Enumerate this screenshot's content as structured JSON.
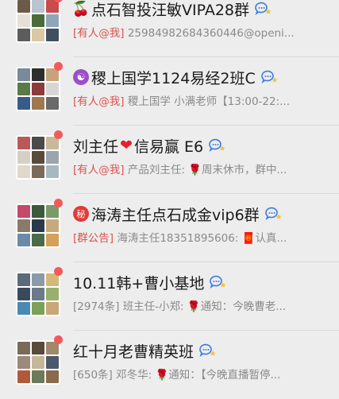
{
  "chats": [
    {
      "title_emoji": "🍒",
      "title": "点石智投汪敏VIPA28群",
      "tag": "[有人@我]",
      "preview": "25984982684360446@openi...",
      "avatar_colors": [
        "#6b5a4a",
        "#b8c4cf",
        "#c94b4b",
        "#e6e0d8",
        "#4a6b3a",
        "#8fa6b8",
        "#5c5c5c",
        "#d9c7a6",
        "#3e4f5f"
      ]
    },
    {
      "title_emoji": "☯",
      "title": "稷上国学1124易经2班C",
      "tag": "[有人@我]",
      "preview": "稷上国学 小满老师【13:00-22:...",
      "avatar_colors": [
        "#7a8a9a",
        "#2d2d2d",
        "#c9a27a",
        "#5a7a4a",
        "#8c3a3a",
        "#d6d6d6",
        "#3a5a8a",
        "#a07850",
        "#6a6a6a"
      ]
    },
    {
      "title_left": "刘主任",
      "title_heart": "❤",
      "title_right": "信易赢 E6",
      "tag": "[有人@我]",
      "preview_before": "产品刘主任: ",
      "preview_rose": "🌹",
      "preview_after": "周末休市，群中...",
      "avatar_colors": [
        "#b85a5a",
        "#4a4a4a",
        "#c8b89a",
        "#d6d0c4",
        "#5a4a3a",
        "#9aa5b0",
        "#e0d8cc",
        "#7a6a5a",
        "#a8b8c0"
      ]
    },
    {
      "title_emoji": "秘",
      "title": "海涛主任点石成金vip6群",
      "tag": "[群公告]",
      "preview": "海涛主任18351895606: ",
      "preview_env": "🧧",
      "preview_after": "认真...",
      "avatar_colors": [
        "#c44a6a",
        "#3a5a3a",
        "#7a9a6a",
        "#8a7a6a",
        "#2a3a4a",
        "#c8aa7a",
        "#6a8aaa",
        "#4a6a4a",
        "#d4a05a"
      ]
    },
    {
      "title": "10.11韩+曹小基地",
      "tag": "[2974条]",
      "preview_before": "班主任-小郑: ",
      "preview_rose": "🌹",
      "preview_after": "通知：今晚曹老...",
      "avatar_colors": [
        "#5a6a7a",
        "#8a9aaa",
        "#d4b87a",
        "#3a4a5a",
        "#6a7a8a",
        "#9ab06a",
        "#4a8ab0",
        "#7aa05a",
        "#c8a878"
      ]
    },
    {
      "title": "红十月老曹精英班",
      "tag": "[650条]",
      "preview_before": "邓冬华: ",
      "preview_rose": "🌹",
      "preview_after": "通知：【今晚直播暂停...",
      "avatar_colors": [
        "#7a6a5a",
        "#5a4a3a",
        "#a08a6a",
        "#9a8a7a",
        "#c4b89a",
        "#4a5a6a",
        "#b05a3a",
        "#6a7a5a",
        "#8a6a4a"
      ]
    }
  ]
}
